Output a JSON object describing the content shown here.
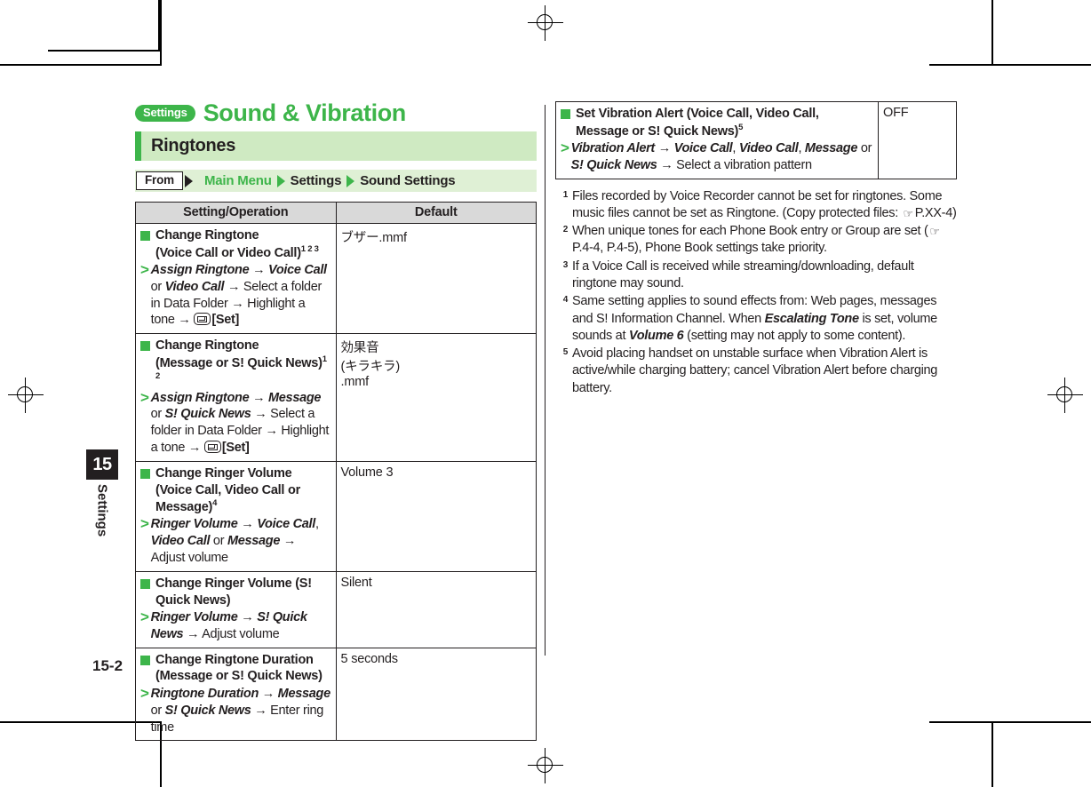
{
  "document": {
    "chapter_badge": "Settings",
    "chapter_title": "Sound & Vibration",
    "section_title": "Ringtones",
    "page_number": "15-2",
    "tab_number": "15",
    "tab_label": "Settings",
    "accent_green": "#3db54a",
    "section_bar_green": "#cfeac2",
    "from_bar_green": "#dff0d5",
    "header_gray": "#d9d9d9"
  },
  "breadcrumb": {
    "from_label": "From",
    "crumb1": "Main Menu",
    "crumb2": "Settings",
    "crumb3": "Sound Settings"
  },
  "table": {
    "headers": {
      "operation": "Setting/Operation",
      "default": "Default"
    },
    "rows": [
      {
        "title_line1": "Change Ringtone",
        "title_line2": "(Voice Call or Video Call)",
        "title_sup": "1 2 3",
        "steps": [
          {
            "t": "Assign Ringtone",
            "bold": true
          },
          {
            "t": " → ",
            "bold": false
          },
          {
            "t": "Voice Call",
            "bold": true
          },
          {
            "t": " or ",
            "bold": false
          },
          {
            "t": "Video Call",
            "bold": true
          },
          {
            "t": " → Select a folder in Data Folder → Highlight a tone → ",
            "bold": false
          }
        ],
        "steps_tail_key": "envelope-key",
        "steps_tail_label": "[Set]",
        "default": "ブザー.mmf"
      },
      {
        "title_line1": "Change Ringtone",
        "title_line2": "(Message or S! Quick News)",
        "title_sup": "1 2",
        "steps": [
          {
            "t": "Assign Ringtone",
            "bold": true
          },
          {
            "t": " → ",
            "bold": false
          },
          {
            "t": "Message",
            "bold": true
          },
          {
            "t": " or ",
            "bold": false
          },
          {
            "t": "S! Quick News",
            "bold": true
          },
          {
            "t": " → Select a folder in Data Folder → Highlight a tone → ",
            "bold": false
          }
        ],
        "steps_tail_key": "envelope-key",
        "steps_tail_label": "[Set]",
        "default": "効果音\n(キラキラ)\n.mmf"
      },
      {
        "title_line1": "Change Ringer Volume",
        "title_line2": "(Voice Call, Video Call or Message)",
        "title_sup": "4",
        "steps": [
          {
            "t": "Ringer Volume",
            "bold": true
          },
          {
            "t": " → ",
            "bold": false
          },
          {
            "t": "Voice Call",
            "bold": true
          },
          {
            "t": ", ",
            "bold": false
          },
          {
            "t": "Video Call",
            "bold": true
          },
          {
            "t": " or ",
            "bold": false
          },
          {
            "t": "Message",
            "bold": true
          },
          {
            "t": " → Adjust volume",
            "bold": false
          }
        ],
        "steps_tail_key": "",
        "steps_tail_label": "",
        "default": "Volume 3"
      },
      {
        "title_line1": "Change Ringer Volume (S! Quick News)",
        "title_line2": "",
        "title_sup": "",
        "steps": [
          {
            "t": "Ringer Volume",
            "bold": true
          },
          {
            "t": " → ",
            "bold": false
          },
          {
            "t": "S! Quick News",
            "bold": true
          },
          {
            "t": " → Adjust volume",
            "bold": false
          }
        ],
        "steps_tail_key": "",
        "steps_tail_label": "",
        "default": "Silent"
      },
      {
        "title_line1": "Change Ringtone Duration",
        "title_line2": "(Message or S! Quick News)",
        "title_sup": "",
        "steps": [
          {
            "t": "Ringtone Duration",
            "bold": true
          },
          {
            "t": " → ",
            "bold": false
          },
          {
            "t": "Message",
            "bold": true
          },
          {
            "t": " or ",
            "bold": false
          },
          {
            "t": "S! Quick News",
            "bold": true
          },
          {
            "t": " → Enter ring time",
            "bold": false
          }
        ],
        "steps_tail_key": "",
        "steps_tail_label": "",
        "default": "5 seconds"
      }
    ],
    "right_rows": [
      {
        "title_line1": "Set Vibration Alert (Voice Call, Video Call,",
        "title_line2": "Message or S! Quick News)",
        "title_sup": "5",
        "steps": [
          {
            "t": "Vibration Alert",
            "bold": true
          },
          {
            "t": " → ",
            "bold": false
          },
          {
            "t": "Voice Call",
            "bold": true
          },
          {
            "t": ", ",
            "bold": false
          },
          {
            "t": "Video Call",
            "bold": true
          },
          {
            "t": ", ",
            "bold": false
          },
          {
            "t": "Message",
            "bold": true
          },
          {
            "t": " or ",
            "bold": false
          },
          {
            "t": "S! Quick News",
            "bold": true
          },
          {
            "t": " → Select a vibration pattern",
            "bold": false
          }
        ],
        "steps_tail_key": "",
        "steps_tail_label": "",
        "default": "OFF"
      }
    ]
  },
  "footnotes": [
    {
      "num": "1",
      "parts": [
        {
          "t": "Files recorded by Voice Recorder cannot be set for ringtones. Some music files cannot be set as Ringtone. (Copy protected files: ",
          "bold": false
        },
        {
          "t": "☞",
          "bold": false,
          "icon": "pointing-hand-icon"
        },
        {
          "t": "P.XX-4)",
          "bold": false
        }
      ]
    },
    {
      "num": "2",
      "parts": [
        {
          "t": "When unique tones for each Phone Book entry or Group are set (",
          "bold": false
        },
        {
          "t": "☞",
          "bold": false,
          "icon": "pointing-hand-icon"
        },
        {
          "t": "P.4-4, P.4-5), Phone Book settings take priority.",
          "bold": false
        }
      ]
    },
    {
      "num": "3",
      "parts": [
        {
          "t": "If a Voice Call is received while streaming/downloading, default ringtone may sound.",
          "bold": false
        }
      ]
    },
    {
      "num": "4",
      "parts": [
        {
          "t": "Same setting applies to sound effects from: Web pages, messages and S! Information Channel. When ",
          "bold": false
        },
        {
          "t": "Escalating Tone",
          "bold": true
        },
        {
          "t": " is set, volume sounds at ",
          "bold": false
        },
        {
          "t": "Volume 6",
          "bold": true
        },
        {
          "t": " (setting may not apply to some content).",
          "bold": false
        }
      ]
    },
    {
      "num": "5",
      "parts": [
        {
          "t": "Avoid placing handset on unstable surface when Vibration Alert is active/while charging battery; cancel Vibration Alert before charging battery.",
          "bold": false
        }
      ]
    }
  ]
}
